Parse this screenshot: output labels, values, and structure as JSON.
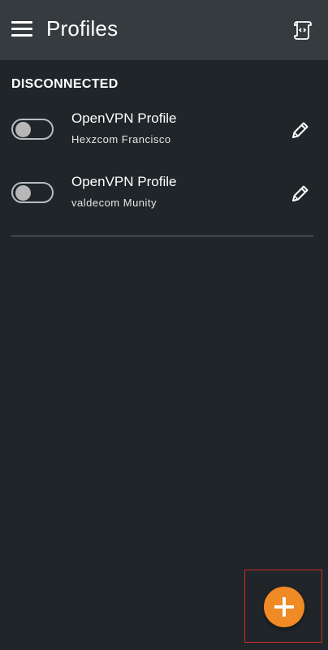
{
  "toolbar": {
    "title": "Profiles",
    "menu_icon": "hamburger-menu-icon",
    "log_icon": "scroll-code-icon",
    "background": "#353b3e"
  },
  "section": {
    "header": "DISCONNECTED"
  },
  "profiles": [
    {
      "name": "OpenVPN Profile",
      "subtitle": "Hexzcom Francisco",
      "connected": false
    },
    {
      "name": "OpenVPN Profile",
      "subtitle": "valdecom Munity",
      "connected": false
    }
  ],
  "fab": {
    "icon": "plus-icon",
    "color": "#f08a24"
  },
  "colors": {
    "background": "#1f2528",
    "accent": "#f08a24"
  }
}
